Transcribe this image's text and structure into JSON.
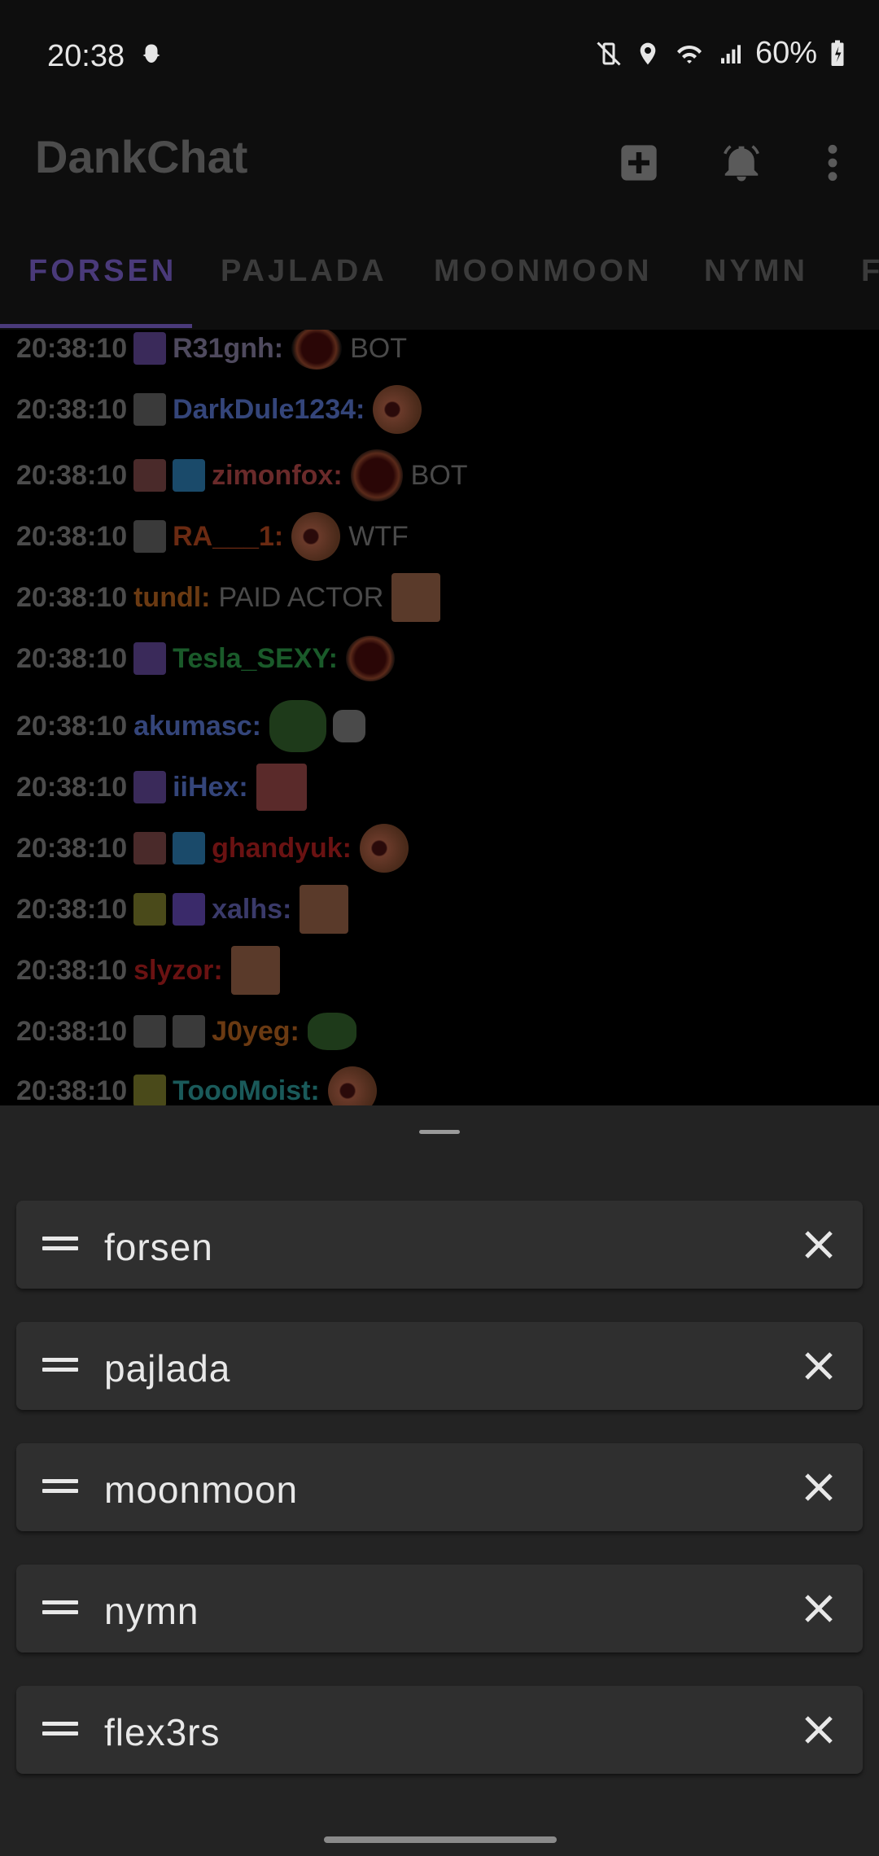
{
  "status_bar": {
    "time": "20:38",
    "battery": "60%"
  },
  "toolbar": {
    "title": "DankChat",
    "icons": [
      "add-box-icon",
      "bell-icon",
      "more-vert-icon"
    ]
  },
  "tabs": [
    {
      "label": "FORSEN",
      "active": true
    },
    {
      "label": "PAJLADA",
      "active": false
    },
    {
      "label": "MOONMOON",
      "active": false
    },
    {
      "label": "NYMN",
      "active": false
    },
    {
      "label": "F",
      "active": false
    }
  ],
  "chat": {
    "messages": [
      {
        "time": "20:38:10",
        "user": "R31gnh:",
        "user_color": "#4f4a5e",
        "text": "BOT"
      },
      {
        "time": "20:38:10",
        "user": "DarkDule1234:",
        "user_color": "#34457a",
        "text": ""
      },
      {
        "time": "20:38:10",
        "user": "zimonfox:",
        "user_color": "#6a2a2a",
        "text": "BOT"
      },
      {
        "time": "20:38:10",
        "user": "RA___1:",
        "user_color": "#6b2a12",
        "text": "WTF"
      },
      {
        "time": "20:38:10",
        "user": "tundl:",
        "user_color": "#6b3a12",
        "text": "PAID ACTOR"
      },
      {
        "time": "20:38:10",
        "user": "Tesla_SEXY:",
        "user_color": "#1a5a2a",
        "text": ""
      },
      {
        "time": "20:38:10",
        "user": "akumasc:",
        "user_color": "#34457a",
        "text": ""
      },
      {
        "time": "20:38:10",
        "user": "iiHex:",
        "user_color": "#34457a",
        "text": ""
      },
      {
        "time": "20:38:10",
        "user": "ghandyuk:",
        "user_color": "#6a1212",
        "text": ""
      },
      {
        "time": "20:38:10",
        "user": "xalhs:",
        "user_color": "#3a3a6a",
        "text": ""
      },
      {
        "time": "20:38:10",
        "user": "slyzor:",
        "user_color": "#6a1212",
        "text": ""
      },
      {
        "time": "20:38:10",
        "user": "J0yeg:",
        "user_color": "#6b3a12",
        "text": ""
      },
      {
        "time": "20:38:10",
        "user": "ToooMoist:",
        "user_color": "#1a5a5a",
        "text": ""
      }
    ]
  },
  "channels": [
    {
      "name": "forsen"
    },
    {
      "name": "pajlada"
    },
    {
      "name": "moonmoon"
    },
    {
      "name": "nymn"
    },
    {
      "name": "flex3rs"
    }
  ],
  "colors": {
    "accent": "#4a3a7a",
    "sheet_bg": "#232323",
    "row_bg": "#2f2f2f"
  }
}
